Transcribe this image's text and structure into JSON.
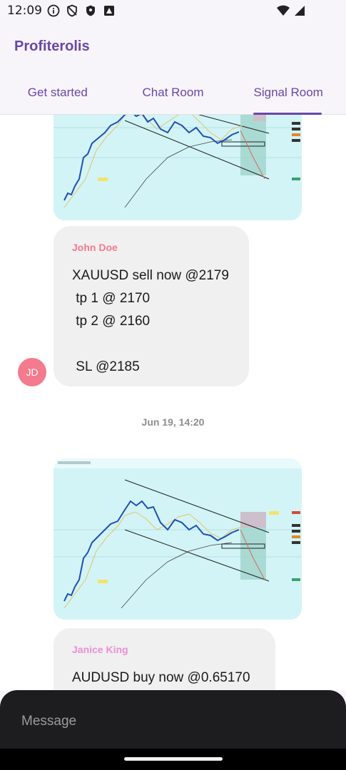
{
  "status": {
    "time": "12:09",
    "icons": [
      "info-icon",
      "shield-off-icon",
      "shield-icon",
      "app-notification-icon"
    ],
    "right_icons": [
      "wifi-icon",
      "signal-icon"
    ]
  },
  "app": {
    "title": "Profiterolis"
  },
  "tabs": [
    {
      "label": "Get started"
    },
    {
      "label": "Chat Room"
    },
    {
      "label": "Signal Room"
    }
  ],
  "messages": [
    {
      "sender": "John Doe",
      "sender_color": "#f47a8e",
      "avatar": "JD",
      "text": "XAUUSD sell now @2179\n tp 1 @ 2170\n tp 2 @ 2160\n\n SL @2185"
    },
    {
      "sender": "Janice King",
      "sender_color": "#e98fd5",
      "text": "AUDUSD buy now @0.65170"
    }
  ],
  "date_separator": "Jun 19, 14:20",
  "composer": {
    "placeholder": "Message"
  },
  "colors": {
    "accent": "#6b46a8",
    "chart_bg": "#d2f4f6"
  }
}
